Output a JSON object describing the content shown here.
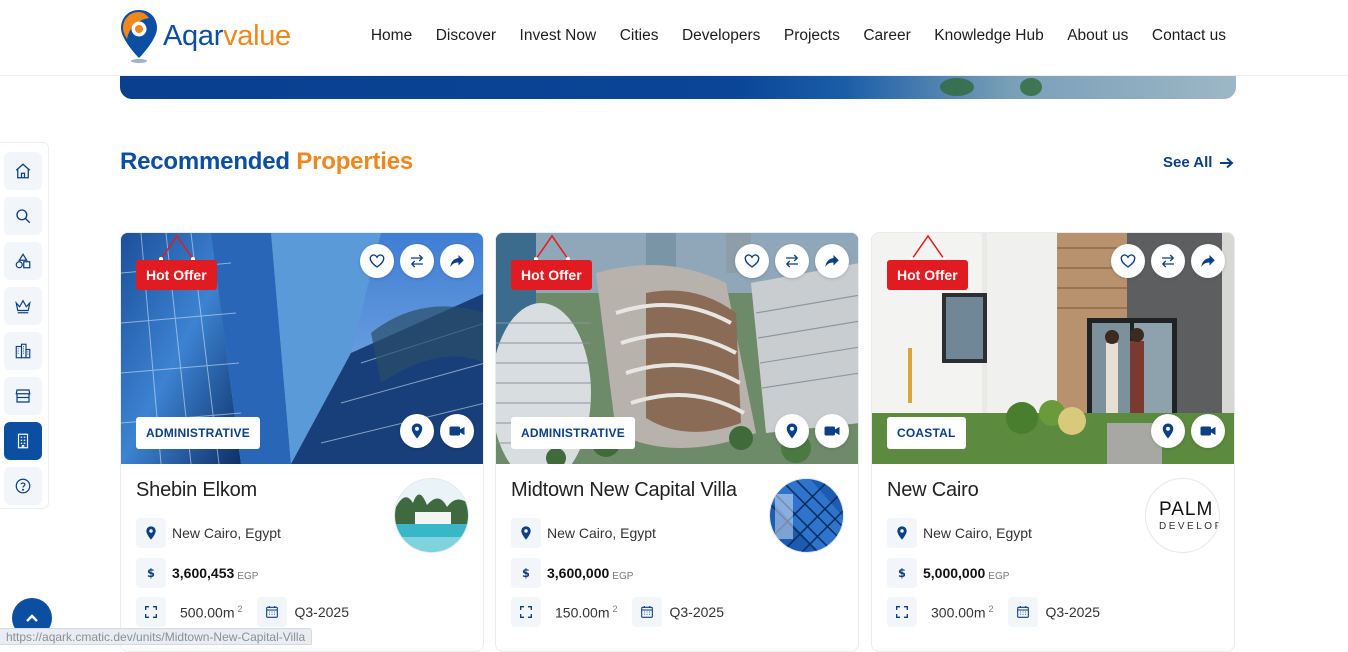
{
  "brand": {
    "name_part1": "Aqar",
    "name_part2": "value"
  },
  "nav": [
    "Home",
    "Discover",
    "Invest Now",
    "Cities",
    "Developers",
    "Projects",
    "Career",
    "Knowledge Hub",
    "About us",
    "Contact us"
  ],
  "sidebar": {
    "items": [
      {
        "icon": "home-icon"
      },
      {
        "icon": "search-icon"
      },
      {
        "icon": "shapes-icon"
      },
      {
        "icon": "crown-icon"
      },
      {
        "icon": "buildings-icon"
      },
      {
        "icon": "store-icon"
      },
      {
        "icon": "office-building-icon",
        "active": true
      },
      {
        "icon": "help-icon"
      }
    ]
  },
  "section": {
    "title_part1": "Recommended",
    "title_part2": "Properties",
    "see_all": "See All"
  },
  "cards": [
    {
      "badge": "Hot Offer",
      "type": "ADMINISTRATIVE",
      "title": "Shebin Elkom",
      "location": "New Cairo, Egypt",
      "price": "3,600,453",
      "currency": "EGP",
      "area": "500.00m",
      "area_sup": "2",
      "delivery": "Q3-2025"
    },
    {
      "badge": "Hot Offer",
      "type": "ADMINISTRATIVE",
      "title": "Midtown New Capital Villa",
      "location": "New Cairo, Egypt",
      "price": "3,600,000",
      "currency": "EGP",
      "area": "150.00m",
      "area_sup": "2",
      "delivery": "Q3-2025"
    },
    {
      "badge": "Hot Offer",
      "type": "COASTAL",
      "title": "New Cairo",
      "location": "New Cairo, Egypt",
      "price": "5,000,000",
      "currency": "EGP",
      "area": "300.00m",
      "area_sup": "2",
      "delivery": "Q3-2025",
      "dev_logo_text1": "PALM H",
      "dev_logo_text2": "DEVELOP"
    }
  ],
  "status_url": "https://aqark.cmatic.dev/units/Midtown-New-Capital-Villa",
  "colors": {
    "primary": "#0b4ea2",
    "accent": "#f0871c",
    "hot": "#e11b22"
  }
}
